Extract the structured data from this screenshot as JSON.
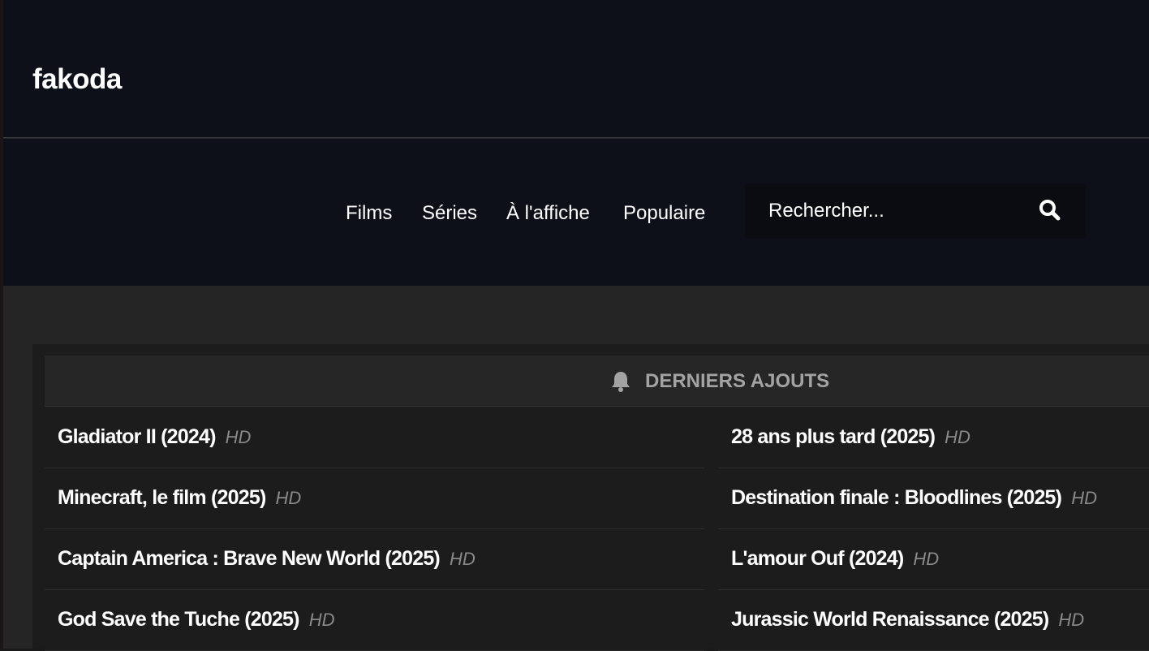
{
  "site": {
    "logo": "fakoda"
  },
  "nav": {
    "items": [
      {
        "label": "Films"
      },
      {
        "label": "Séries"
      },
      {
        "label": "À l'affiche"
      },
      {
        "label": "Populaire"
      }
    ]
  },
  "search": {
    "placeholder": "Rechercher...",
    "icon": "search-icon"
  },
  "latest": {
    "heading": "DERNIERS AJOUTS",
    "icon": "bell-icon",
    "left": [
      {
        "title": "Gladiator II (2024)",
        "quality": "HD"
      },
      {
        "title": "Minecraft, le film (2025)",
        "quality": "HD"
      },
      {
        "title": "Captain America : Brave New World (2025)",
        "quality": "HD"
      },
      {
        "title": "God Save the Tuche (2025)",
        "quality": "HD"
      }
    ],
    "right": [
      {
        "title": "28 ans plus tard (2025)",
        "quality": "HD"
      },
      {
        "title": "Destination finale : Bloodlines (2025)",
        "quality": "HD"
      },
      {
        "title": "L'amour Ouf (2024)",
        "quality": "HD"
      },
      {
        "title": "Jurassic World Renaissance (2025)",
        "quality": "HD"
      }
    ]
  }
}
